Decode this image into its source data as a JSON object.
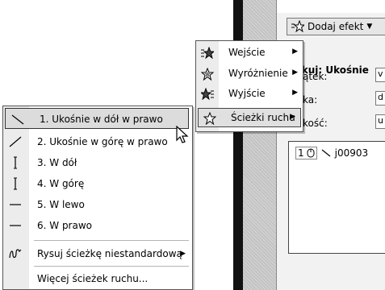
{
  "task_pane": {
    "add_effect_label": "Dodaj efekt",
    "heading": "yfikuj: Ukośnie",
    "fields": [
      {
        "label": "ątek:",
        "value": "v"
      },
      {
        "label": "ka:",
        "value": "d"
      },
      {
        "label": "kość:",
        "value": "u"
      }
    ],
    "list_item": {
      "number": "1",
      "name": "j00903"
    }
  },
  "submenu": {
    "items": [
      {
        "label": "Wejście",
        "icon": "star-enter-icon",
        "has_arrow": true
      },
      {
        "label": "Wyróżnienie",
        "icon": "star-emphasis-icon",
        "has_arrow": true
      },
      {
        "label": "Wyjście",
        "icon": "star-exit-icon",
        "has_arrow": true
      },
      {
        "label": "Ścieżki ruchu",
        "icon": "star-motion-icon",
        "has_arrow": true,
        "active": true
      }
    ]
  },
  "motion_menu": {
    "items": [
      {
        "label": "1. Ukośnie w dół w prawo",
        "icon": "diagonal-down-right-icon",
        "active": true
      },
      {
        "label": "2. Ukośnie w górę w prawo",
        "icon": "diagonal-up-right-icon"
      },
      {
        "label": "3. W dół",
        "icon": "line-down-icon"
      },
      {
        "label": "4. W górę",
        "icon": "line-up-icon"
      },
      {
        "label": "5. W lewo",
        "icon": "line-left-icon"
      },
      {
        "label": "6. W prawo",
        "icon": "line-right-icon"
      },
      {
        "label": "Rysuj ścieżkę niestandardową",
        "icon": "freeform-path-icon",
        "has_arrow": true
      },
      {
        "label": "Więcej ścieżek ruchu...",
        "icon": ""
      }
    ]
  }
}
